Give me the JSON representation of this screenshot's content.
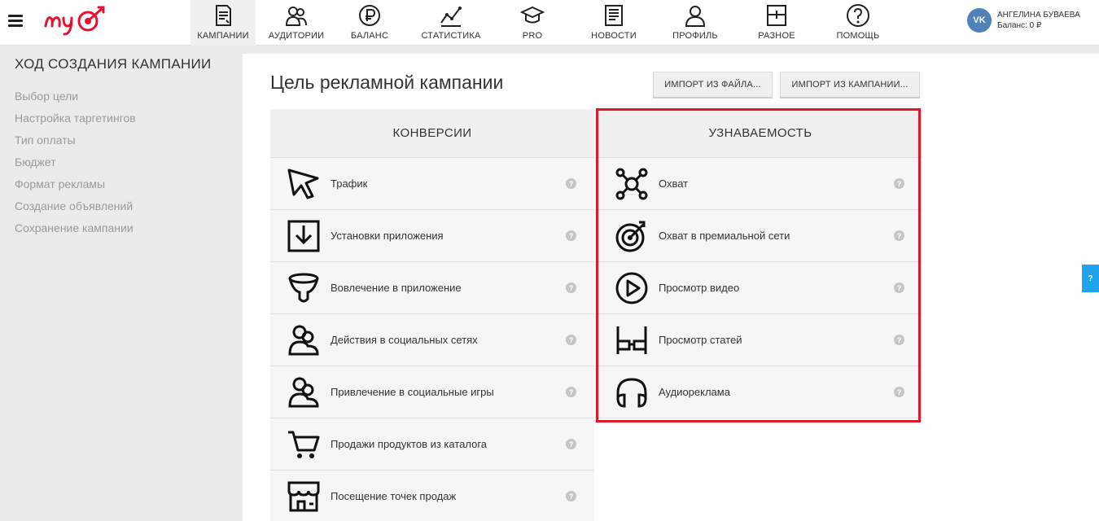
{
  "user": {
    "name": "АНГЕЛИНА БУВАЕВА",
    "balance": "Баланс: 0 ₽",
    "network": "VK"
  },
  "nav": [
    {
      "label": "КАМПАНИИ",
      "icon": "campaigns-icon"
    },
    {
      "label": "АУДИТОРИИ",
      "icon": "audiences-icon"
    },
    {
      "label": "БАЛАНС",
      "icon": "balance-icon"
    },
    {
      "label": "СТАТИСТИКА",
      "icon": "statistics-icon"
    },
    {
      "label": "PRO",
      "icon": "pro-icon"
    },
    {
      "label": "НОВОСТИ",
      "icon": "news-icon"
    },
    {
      "label": "ПРОФИЛЬ",
      "icon": "profile-icon"
    },
    {
      "label": "РАЗНОЕ",
      "icon": "misc-icon"
    },
    {
      "label": "ПОМОЩЬ",
      "icon": "help-icon"
    }
  ],
  "sidebar": {
    "title": "ХОД СОЗДАНИЯ КАМПАНИИ",
    "steps": [
      "Выбор цели",
      "Настройка таргетингов",
      "Тип оплаты",
      "Бюджет",
      "Формат рекламы",
      "Создание объявлений",
      "Сохранение кампании"
    ]
  },
  "main": {
    "title": "Цель рекламной кампании",
    "import_file": "ИМПОРТ ИЗ ФАЙЛА...",
    "import_campaign": "ИМПОРТ ИЗ КАМПАНИИ..."
  },
  "conversions": {
    "header": "КОНВЕРСИИ",
    "items": [
      {
        "label": "Трафик",
        "icon": "cursor-icon"
      },
      {
        "label": "Установки приложения",
        "icon": "download-icon"
      },
      {
        "label": "Вовлечение в приложение",
        "icon": "funnel-icon"
      },
      {
        "label": "Действия в социальных сетях",
        "icon": "social-icon"
      },
      {
        "label": "Привлечение в социальные игры",
        "icon": "social-games-icon"
      },
      {
        "label": "Продажи продуктов из каталога",
        "icon": "cart-icon"
      },
      {
        "label": "Посещение точек продаж",
        "icon": "store-icon"
      }
    ]
  },
  "awareness": {
    "header": "УЗНАВАЕМОСТЬ",
    "items": [
      {
        "label": "Охват",
        "icon": "reach-icon"
      },
      {
        "label": "Охват в премиальной сети",
        "icon": "target-icon"
      },
      {
        "label": "Просмотр видео",
        "icon": "play-icon"
      },
      {
        "label": "Просмотр статей",
        "icon": "glasses-icon"
      },
      {
        "label": "Аудиореклама",
        "icon": "headphones-icon"
      }
    ]
  },
  "help_mark": "?",
  "colors": {
    "highlight": "#e0182d",
    "logo": "#e8112d",
    "help_tab": "#1fa3ec"
  }
}
